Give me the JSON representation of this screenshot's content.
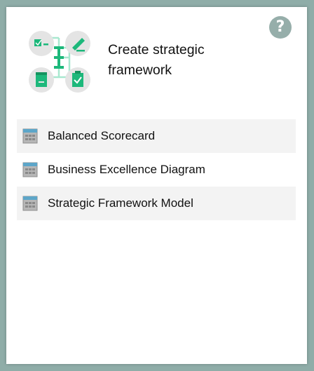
{
  "dialog": {
    "title_line1": "Create strategic",
    "title_line2": "framework",
    "help_label": "?"
  },
  "templates": [
    {
      "label": "Balanced Scorecard",
      "icon": "table-template-icon"
    },
    {
      "label": "Business Excellence Diagram",
      "icon": "table-template-icon"
    },
    {
      "label": "Strategic Framework Model",
      "icon": "table-template-icon"
    }
  ],
  "colors": {
    "accent_green": "#1db87b",
    "illustration_circle": "#e4e4e4",
    "connector": "#a8e8cf",
    "help_button": "#96aeaa",
    "backdrop": "#8fada8"
  }
}
